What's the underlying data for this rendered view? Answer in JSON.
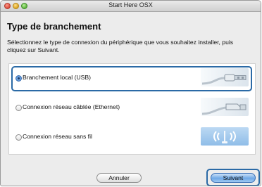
{
  "window": {
    "title": "Start Here OSX"
  },
  "page": {
    "heading": "Type de branchement",
    "instructions": "Sélectionnez le type de connexion du périphérique que vous souhaitez installer, puis cliquez sur Suivant."
  },
  "options": [
    {
      "label": "Branchement local (USB)",
      "selected": true,
      "icon": "usb-cable-icon"
    },
    {
      "label": "Connexion réseau câblée (Ethernet)",
      "selected": false,
      "icon": "ethernet-cable-icon"
    },
    {
      "label": "Connexion réseau sans fil",
      "selected": false,
      "icon": "wireless-icon"
    }
  ],
  "buttons": {
    "cancel": "Annuler",
    "continue": "Suivant"
  },
  "colors": {
    "highlight_ring": "#2b6aa6",
    "default_button": "#6fa8e6"
  }
}
